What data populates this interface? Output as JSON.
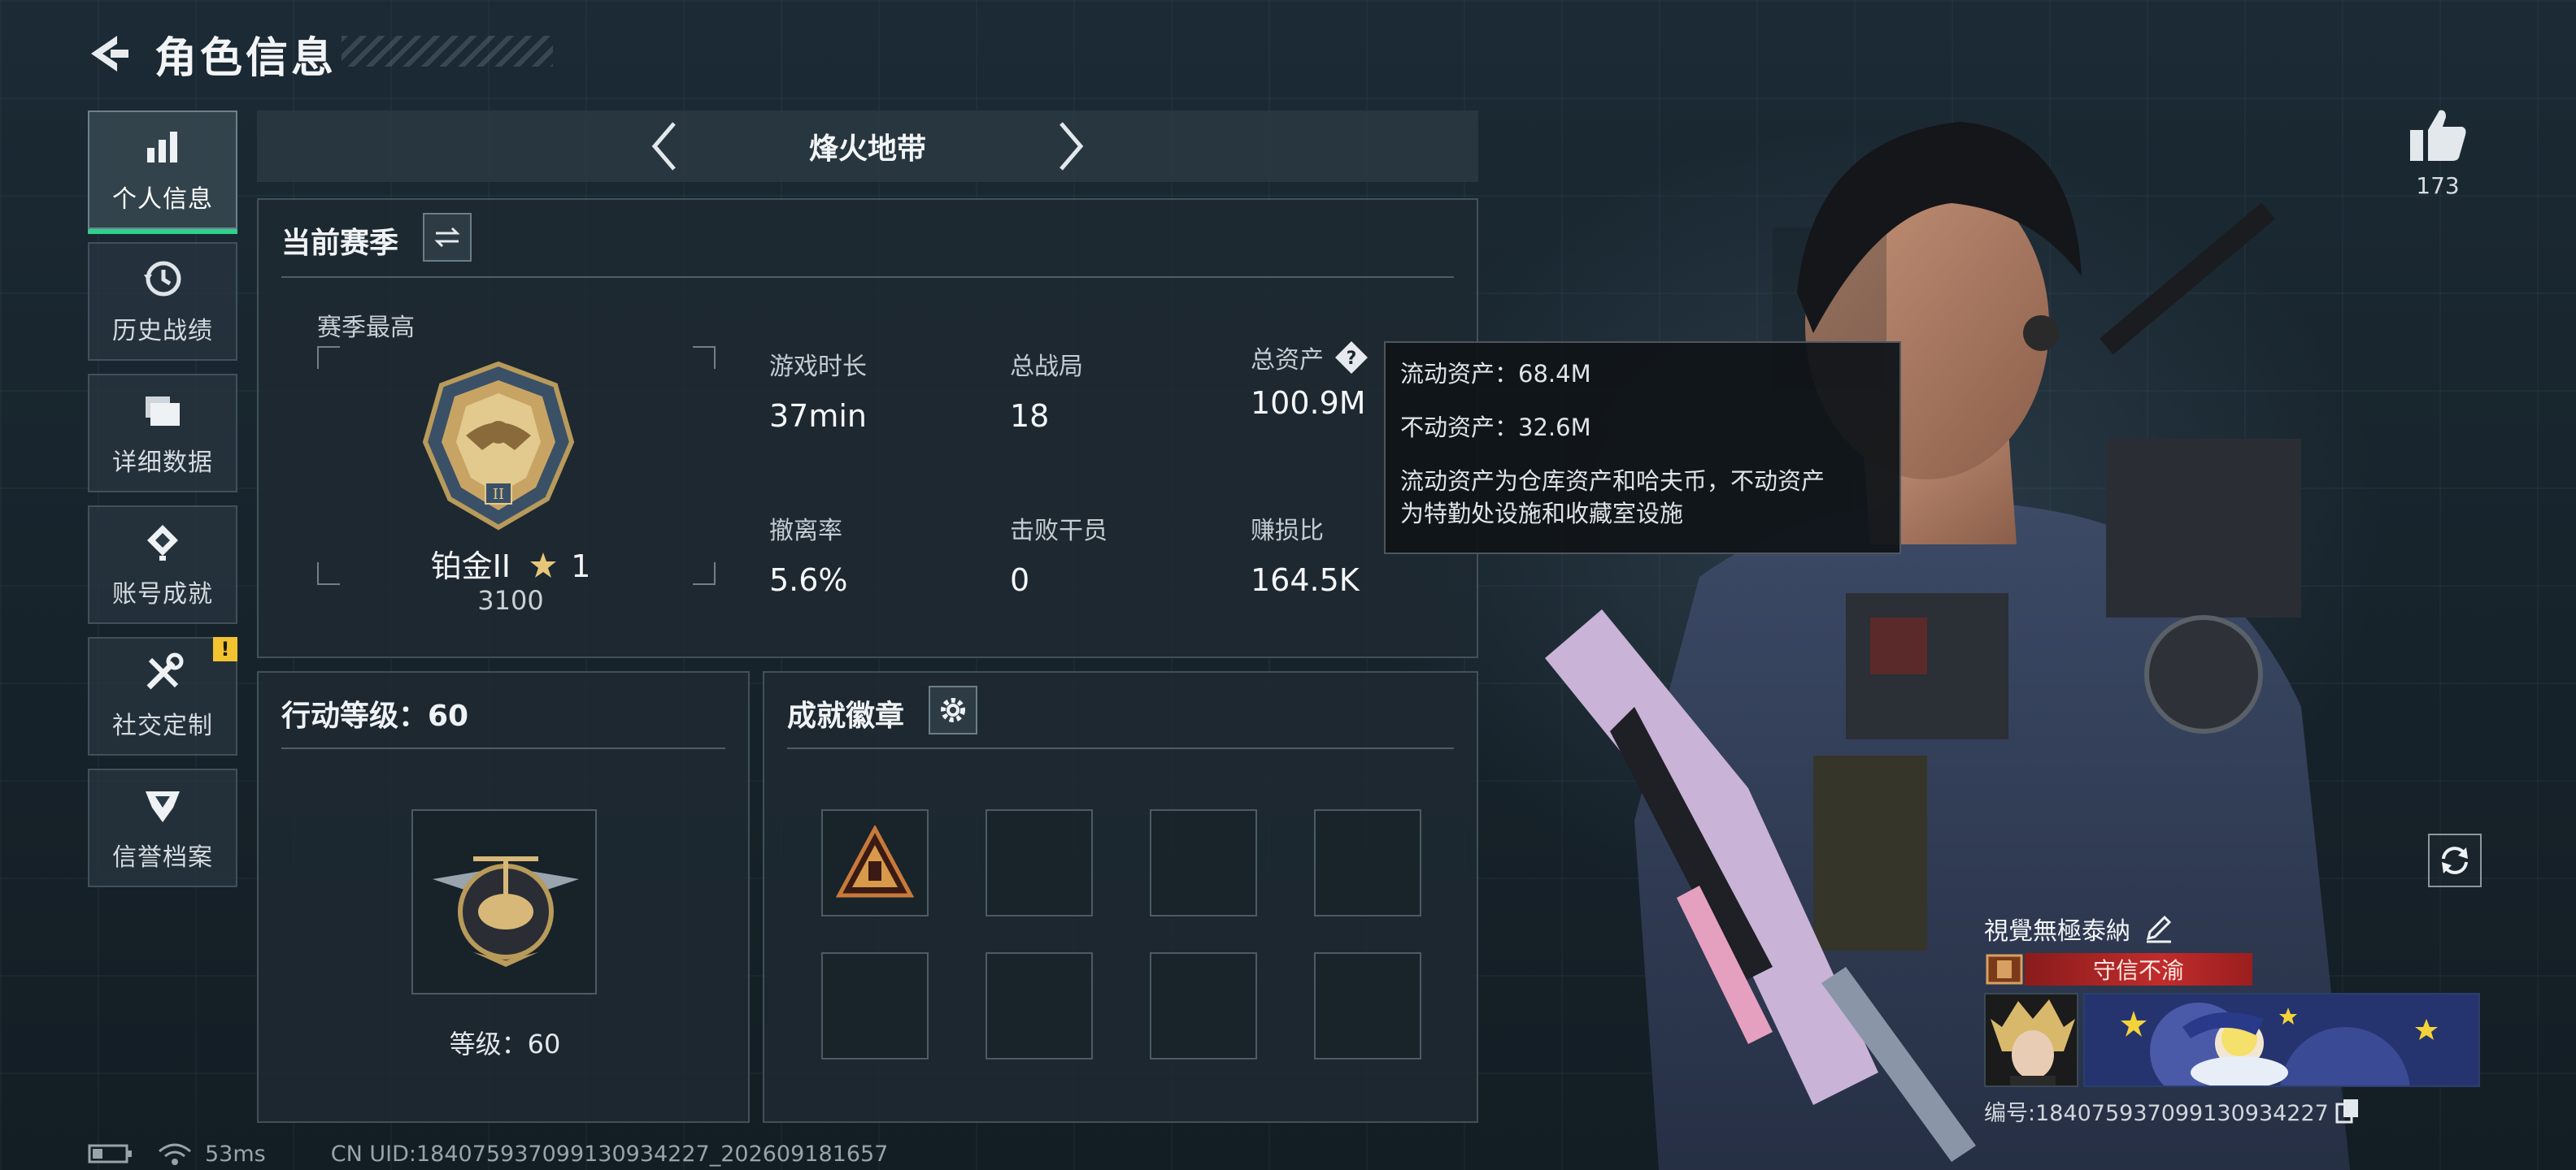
{
  "header": {
    "title": "角色信息"
  },
  "sidebar": {
    "items": [
      {
        "label": "个人信息",
        "icon": "bar-chart-icon",
        "active": true
      },
      {
        "label": "历史战绩",
        "icon": "history-clock-icon"
      },
      {
        "label": "详细数据",
        "icon": "folder-data-icon"
      },
      {
        "label": "账号成就",
        "icon": "achievement-diamond-icon"
      },
      {
        "label": "社交定制",
        "icon": "wrench-screwdriver-icon",
        "alert": "!"
      },
      {
        "label": "信誉档案",
        "icon": "reputation-shield-icon"
      }
    ]
  },
  "mode_selector": {
    "title": "烽火地带"
  },
  "season": {
    "title": "当前赛季",
    "season_high_label": "赛季最高",
    "rank_name": "铂金II",
    "rank_stars": "1",
    "rank_score": "3100",
    "stats": [
      {
        "label": "游戏时长",
        "value": "37min"
      },
      {
        "label": "总战局",
        "value": "18"
      },
      {
        "label": "总资产",
        "value": "100.9M"
      },
      {
        "label": "撤离率",
        "value": "5.6%"
      },
      {
        "label": "击败干员",
        "value": "0"
      },
      {
        "label": "赚损比",
        "value": "164.5K"
      }
    ]
  },
  "assets_tooltip": {
    "liquid": "流动资产：68.4M",
    "fixed": "不动资产：32.6M",
    "desc_line1": "流动资产为仓库资产和哈夫币，不动资产",
    "desc_line2": "为特勤处设施和收藏室设施"
  },
  "action_level": {
    "title": "行动等级：60",
    "level_text": "等级：60"
  },
  "badges": {
    "title": "成就徽章"
  },
  "likes": {
    "count": "173"
  },
  "profile": {
    "name": "視覺無極泰納",
    "title_tag": "守信不渝",
    "uid_label": "编号:18407593709913093422​7"
  },
  "status": {
    "ping": "53ms",
    "uid_footer": "CN UID:18407593709913093422​7_202609181657"
  },
  "colors": {
    "accent_green": "#2fd18c",
    "alert_yellow": "#f2c230",
    "title_tag_red": "#c12c2c"
  }
}
